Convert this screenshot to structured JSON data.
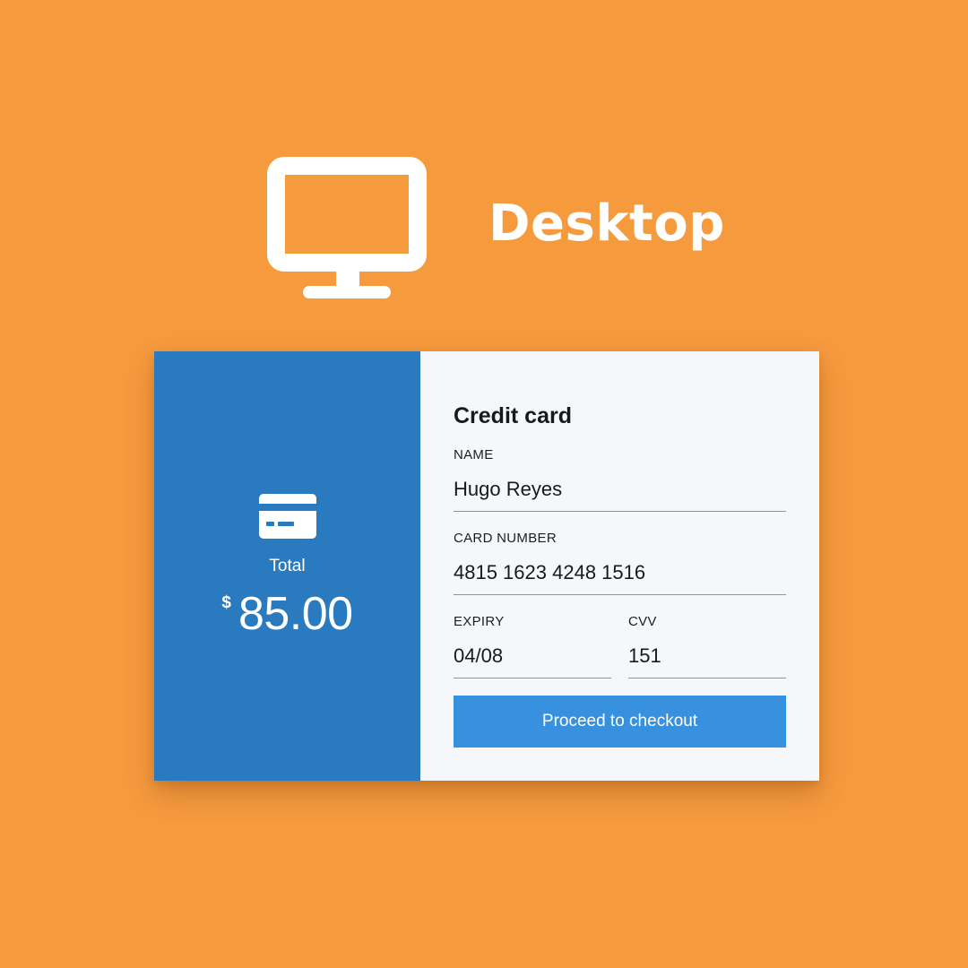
{
  "header": {
    "title": "Desktop",
    "icon": "monitor-icon"
  },
  "colors": {
    "background": "#f69a3e",
    "summary_panel": "#2a7abf",
    "form_panel": "#f5f7fb",
    "button": "#3791de",
    "text_dark": "#16191d",
    "divider": "#8f949c"
  },
  "summary": {
    "icon": "credit-card-icon",
    "total_label": "Total",
    "currency_symbol": "$",
    "amount": "85.00"
  },
  "form": {
    "title": "Credit card",
    "fields": {
      "name": {
        "label": "NAME",
        "value": "Hugo Reyes"
      },
      "card_number": {
        "label": "CARD NUMBER",
        "value": "4815 1623 4248 1516"
      },
      "expiry": {
        "label": "EXPIRY",
        "value": "04/08"
      },
      "cvv": {
        "label": "CVV",
        "value": "151"
      }
    },
    "submit_label": "Proceed to checkout"
  }
}
